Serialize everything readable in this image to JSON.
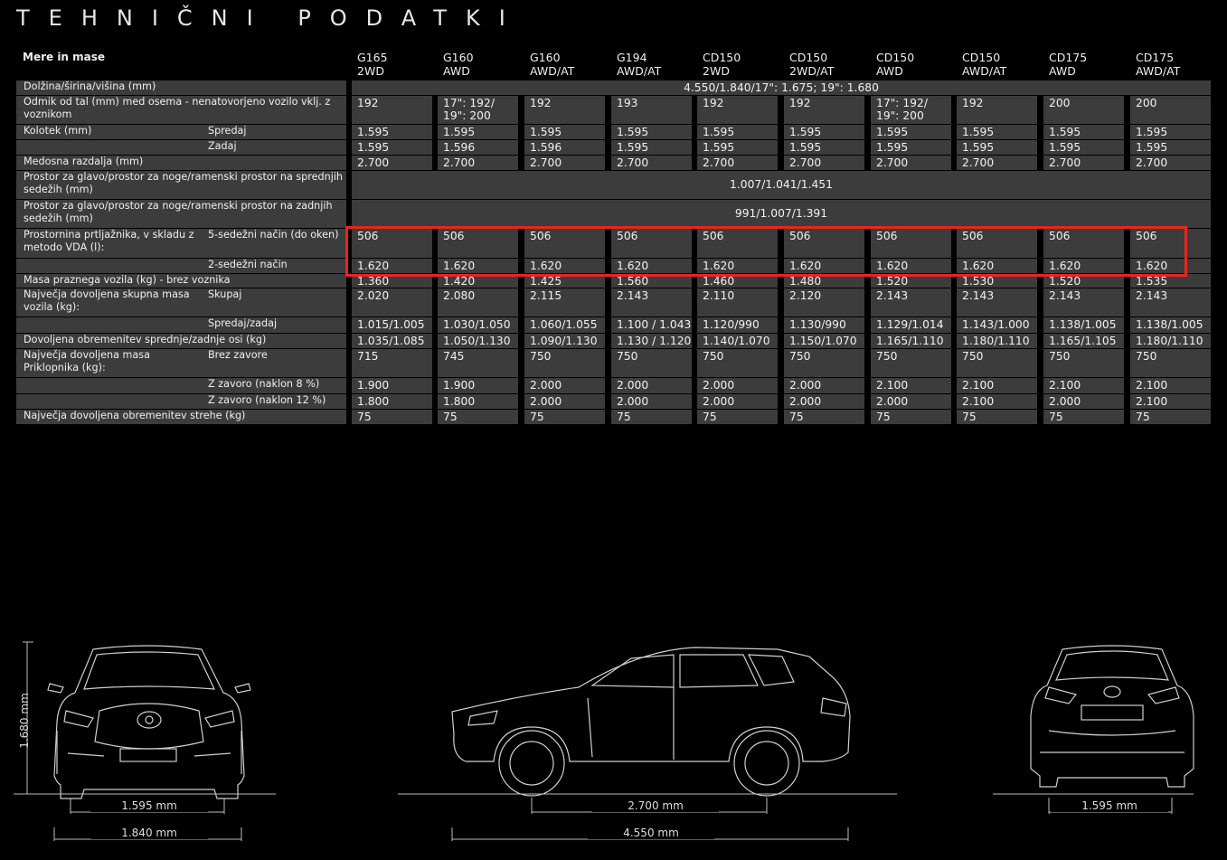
{
  "page_title": "TEHNIČNI PODATKI",
  "section_title": "Mere in mase",
  "columns": [
    {
      "code": "G165",
      "drive": "2WD"
    },
    {
      "code": "G160",
      "drive": "AWD"
    },
    {
      "code": "G160",
      "drive": "AWD/AT"
    },
    {
      "code": "G194",
      "drive": "AWD/AT"
    },
    {
      "code": "CD150",
      "drive": "2WD"
    },
    {
      "code": "CD150",
      "drive": "2WD/AT"
    },
    {
      "code": "CD150",
      "drive": "AWD"
    },
    {
      "code": "CD150",
      "drive": "AWD/AT"
    },
    {
      "code": "CD175",
      "drive": "AWD"
    },
    {
      "code": "CD175",
      "drive": "AWD/AT"
    }
  ],
  "rows": [
    {
      "label": "Dolžina/širina/višina (mm)",
      "sub": "",
      "span": "4.550/1.840/17\": 1.675; 19\": 1.680"
    },
    {
      "label": "Odmik od tal (mm) med osema - nenatovorjeno vozilo vklj. z voznikom",
      "sub": "",
      "values": [
        "192",
        "17\": 192/ 19\": 200",
        "192",
        "193",
        "192",
        "192",
        "17\": 192/ 19\": 200",
        "192",
        "200",
        "200"
      ]
    },
    {
      "label": "Kolotek (mm)",
      "sub": "Spredaj",
      "values": [
        "1.595",
        "1.595",
        "1.595",
        "1.595",
        "1.595",
        "1.595",
        "1.595",
        "1.595",
        "1.595",
        "1.595"
      ]
    },
    {
      "label": "",
      "sub": "Zadaj",
      "values": [
        "1.595",
        "1.596",
        "1.596",
        "1.595",
        "1.595",
        "1.595",
        "1.595",
        "1.595",
        "1.595",
        "1.595"
      ]
    },
    {
      "label": "Medosna razdalja (mm)",
      "sub": "",
      "values": [
        "2.700",
        "2.700",
        "2.700",
        "2.700",
        "2.700",
        "2.700",
        "2.700",
        "2.700",
        "2.700",
        "2.700"
      ]
    },
    {
      "label": "Prostor za glavo/prostor za noge/ramenski prostor na sprednjih sedežih (mm)",
      "sub": "",
      "span": "1.007/1.041/1.451"
    },
    {
      "label": "Prostor za glavo/prostor za noge/ramenski prostor na zadnjih sedežih (mm)",
      "sub": "",
      "span": "991/1.007/1.391"
    },
    {
      "label": "Prostornina prtljažnika, v skladu z metodo VDA (l):",
      "sub": "5-sedežni način (do oken)",
      "values": [
        "506",
        "506",
        "506",
        "506",
        "506",
        "506",
        "506",
        "506",
        "506",
        "506"
      ]
    },
    {
      "label": "",
      "sub": "2-sedežni način",
      "values": [
        "1.620",
        "1.620",
        "1.620",
        "1.620",
        "1.620",
        "1.620",
        "1.620",
        "1.620",
        "1.620",
        "1.620"
      ]
    },
    {
      "label": "Masa praznega vozila (kg) - brez voznika",
      "sub": "",
      "values": [
        "1.360",
        "1.420",
        "1.425",
        "1.560",
        "1.460",
        "1.480",
        "1.520",
        "1.530",
        "1.520",
        "1.535"
      ]
    },
    {
      "label": "Največja dovoljena skupna masa vozila (kg):",
      "sub": "Skupaj",
      "values": [
        "2.020",
        "2.080",
        "2.115",
        "2.143",
        "2.110",
        "2.120",
        "2.143",
        "2.143",
        "2.143",
        "2.143"
      ]
    },
    {
      "label": "",
      "sub": "Spredaj/zadaj",
      "values": [
        "1.015/1.005",
        "1.030/1.050",
        "1.060/1.055",
        "1.100 / 1.043",
        "1.120/990",
        "1.130/990",
        "1.129/1.014",
        "1.143/1.000",
        "1.138/1.005",
        "1.138/1.005"
      ]
    },
    {
      "label": "Dovoljena obremenitev sprednje/zadnje osi (kg)",
      "sub": "",
      "values": [
        "1.035/1.085",
        "1.050/1.130",
        "1.090/1.130",
        "1.130 / 1.120",
        "1.140/1.070",
        "1.150/1.070",
        "1.165/1.110",
        "1.180/1.110",
        "1.165/1.105",
        "1.180/1.110"
      ]
    },
    {
      "label": "Največja dovoljena masa Priklopnika (kg):",
      "sub": "Brez zavore",
      "values": [
        "715",
        "745",
        "750",
        "750",
        "750",
        "750",
        "750",
        "750",
        "750",
        "750"
      ]
    },
    {
      "label": "",
      "sub": "Z zavoro (naklon 8 %)",
      "values": [
        "1.900",
        "1.900",
        "2.000",
        "2.000",
        "2.000",
        "2.000",
        "2.100",
        "2.100",
        "2.100",
        "2.100"
      ]
    },
    {
      "label": "",
      "sub": "Z zavoro (naklon 12 %)",
      "values": [
        "1.800",
        "1.800",
        "2.000",
        "2.000",
        "2.000",
        "2.000",
        "2.000",
        "2.100",
        "2.000",
        "2.100"
      ]
    },
    {
      "label": "Največja dovoljena obremenitev strehe (kg)",
      "sub": "",
      "values": [
        "75",
        "75",
        "75",
        "75",
        "75",
        "75",
        "75",
        "75",
        "75",
        "75"
      ]
    }
  ],
  "dimensions": {
    "height": "1.680 mm",
    "front_track": "1.595 mm",
    "width": "1.840 mm",
    "wheelbase": "2.700 mm",
    "length": "4.550 mm",
    "rear_track": "1.595 mm"
  },
  "colors": {
    "background": "#000000",
    "cell": "#3c3c3c",
    "highlight": "#e8261c"
  }
}
